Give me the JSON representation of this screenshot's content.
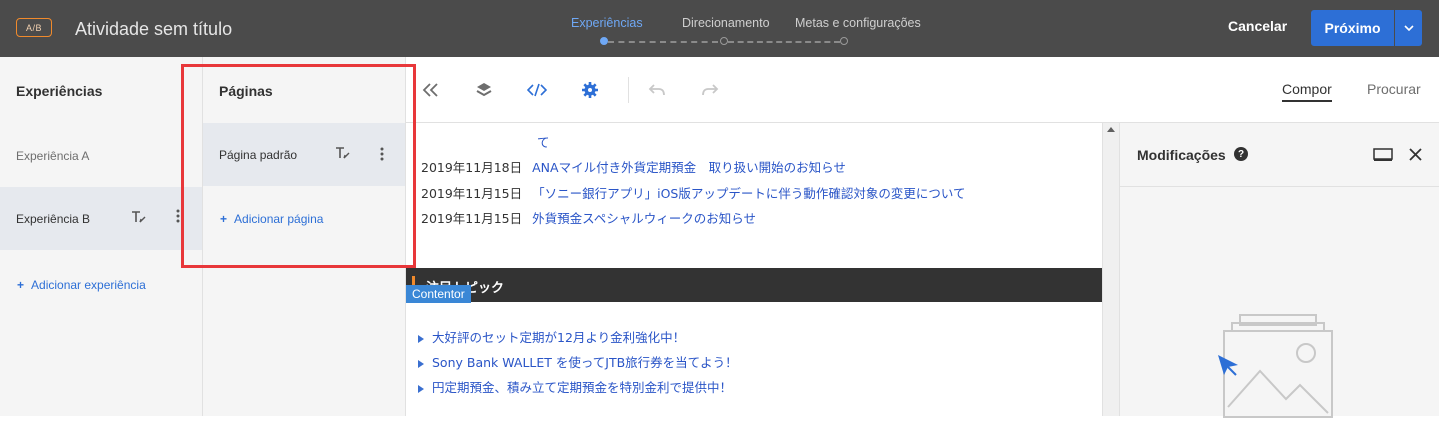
{
  "header": {
    "badge": "A/B",
    "title": "Atividade sem título",
    "steps": [
      "Experiências",
      "Direcionamento",
      "Metas e configurações"
    ],
    "cancel_label": "Cancelar",
    "next_label": "Próximo"
  },
  "experiences": {
    "title": "Experiências",
    "items": [
      {
        "label": "Experiência A"
      },
      {
        "label": "Experiência B"
      }
    ],
    "add_label": "Adicionar experiência"
  },
  "pages": {
    "title": "Páginas",
    "items": [
      {
        "label": "Página padrão"
      }
    ],
    "add_label": "Adicionar página"
  },
  "toolbar": {
    "tabs": [
      "Compor",
      "Procurar"
    ]
  },
  "content": {
    "partial_line": "て",
    "news": [
      {
        "date": "2019年11月18日",
        "text": "ANAマイル付き外貨定期預金　取り扱い開始のお知らせ"
      },
      {
        "date": "2019年11月15日",
        "text": "「ソニー銀行アプリ」iOS版アップデートに伴う動作確認対象の変更について"
      },
      {
        "date": "2019年11月15日",
        "text": "外貨預金スペシャルウィークのお知らせ"
      }
    ],
    "topic_title": "注目トピック",
    "container_tag": "Contentor",
    "bullets": [
      "大好評のセット定期が12月より金利強化中！",
      "Sony Bank WALLET を使ってJTB旅行券を当てよう！",
      "円定期預金、積み立て定期預金を特別金利で提供中！"
    ]
  },
  "modifications": {
    "title": "Modificações"
  },
  "colors": {
    "header_bg": "#4b4b4b",
    "accent_blue": "#2d6fd6",
    "highlight_red": "#e8373a",
    "badge_orange": "#f08a2c"
  }
}
